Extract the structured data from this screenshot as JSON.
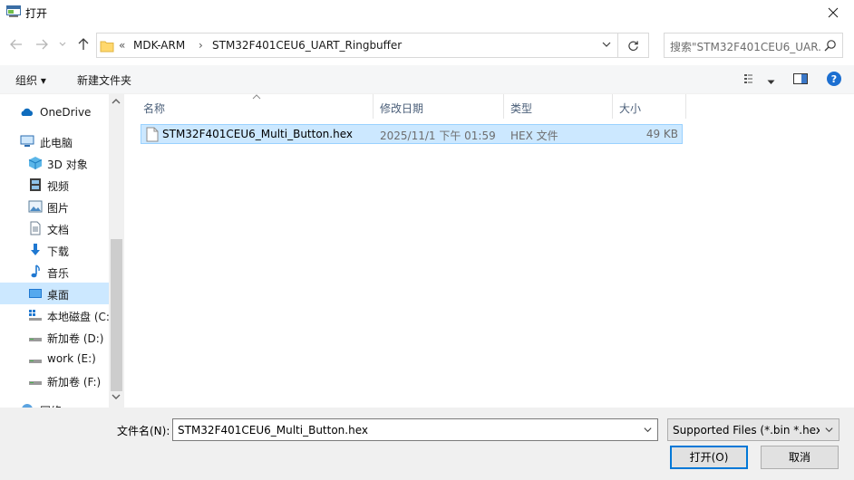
{
  "window": {
    "title": "打开"
  },
  "address": {
    "overflow": "«",
    "crumbs": [
      "MDK-ARM",
      "STM32F401CEU6_UART_Ringbuffer"
    ],
    "separator": "›"
  },
  "search": {
    "placeholder": "搜索\"STM32F401CEU6_UAR..."
  },
  "toolbar": {
    "organize": "组织 ▾",
    "new_folder": "新建文件夹"
  },
  "nav": {
    "items": [
      {
        "label": "OneDrive",
        "icon": "onedrive-icon"
      },
      {
        "label": "此电脑",
        "icon": "this-pc-icon"
      },
      {
        "label": "3D 对象",
        "icon": "3d-objects-icon"
      },
      {
        "label": "视频",
        "icon": "video-icon"
      },
      {
        "label": "图片",
        "icon": "pictures-icon"
      },
      {
        "label": "文档",
        "icon": "documents-icon"
      },
      {
        "label": "下载",
        "icon": "downloads-icon"
      },
      {
        "label": "音乐",
        "icon": "music-icon"
      },
      {
        "label": "桌面",
        "icon": "desktop-icon"
      },
      {
        "label": "本地磁盘 (C:",
        "icon": "system-drive-icon"
      },
      {
        "label": "新加卷 (D:)",
        "icon": "drive-icon"
      },
      {
        "label": "work (E:)",
        "icon": "drive-icon"
      },
      {
        "label": "新加卷 (F:)",
        "icon": "drive-icon"
      },
      {
        "label": "网络",
        "icon": "network-icon"
      }
    ]
  },
  "columns": {
    "name": "名称",
    "date": "修改日期",
    "type": "类型",
    "size": "大小"
  },
  "files": [
    {
      "name": "STM32F401CEU6_Multi_Button.hex",
      "date": "2025/11/1 下午 01:59",
      "type": "HEX 文件",
      "size": "49 KB"
    }
  ],
  "bottom": {
    "filename_label": "文件名(N):",
    "filename_value": "STM32F401CEU6_Multi_Button.hex",
    "filetype_value": "Supported Files (*.bin *.hex *.",
    "open_label": "打开(O)",
    "cancel_label": "取消"
  },
  "colors": {
    "selection": "#cce8ff",
    "selection_border": "#99d1ff",
    "accent": "#0078d7"
  }
}
